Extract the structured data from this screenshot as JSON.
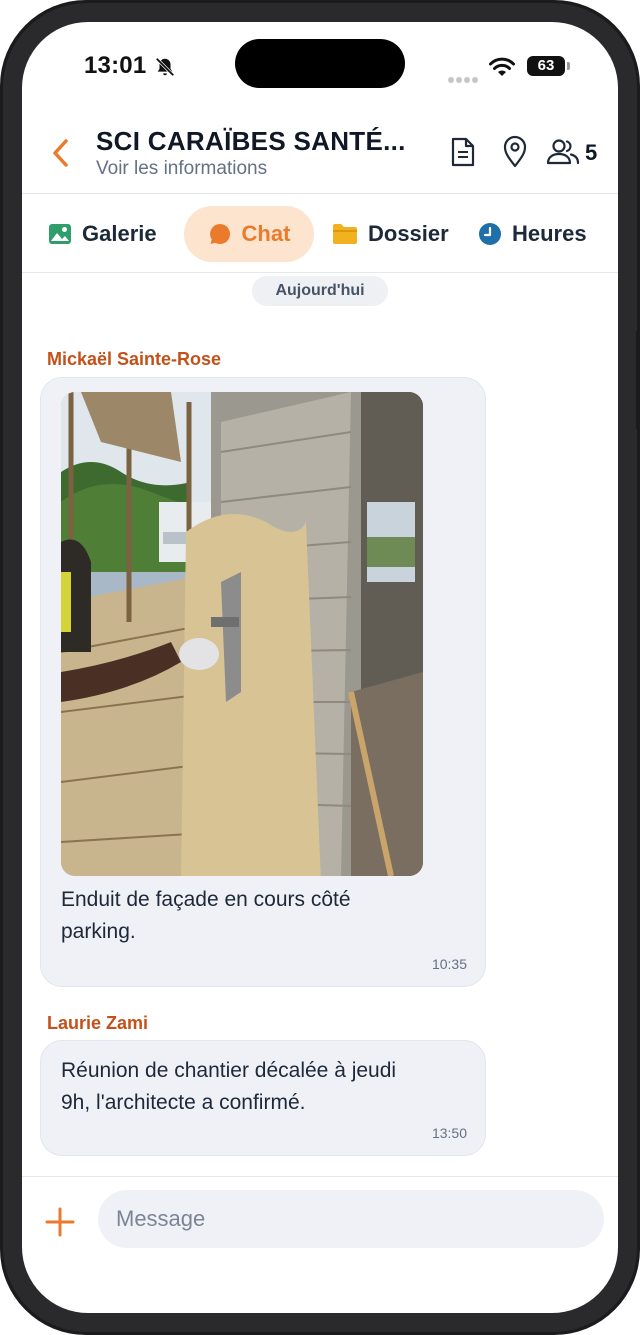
{
  "status_bar": {
    "time": "13:01",
    "battery": "63"
  },
  "header": {
    "title": "SCI CARAÏBES SANTÉ...",
    "subtitle": "Voir les informations",
    "members_count": "5"
  },
  "tabs": [
    {
      "label": "Galerie",
      "icon": "gallery-icon"
    },
    {
      "label": "Chat",
      "icon": "chat-bubble-icon",
      "active": true
    },
    {
      "label": "Dossier",
      "icon": "folder-icon"
    },
    {
      "label": "Heures",
      "icon": "clock-icon"
    }
  ],
  "chat": {
    "day_separator": "Aujourd'hui",
    "messages": [
      {
        "sender": "Mickaël Sainte-Rose",
        "line1": "Enduit de façade en cours côté",
        "line2": "parking.",
        "time": "10:35",
        "has_photo": true
      },
      {
        "sender": "Laurie Zami",
        "line1": "Réunion de chantier décalée à jeudi",
        "line2": "9h, l'architecte a confirmé.",
        "time": "13:50"
      }
    ]
  },
  "composer": {
    "placeholder": "Message"
  },
  "colors": {
    "accent": "#ea7a2c",
    "active_tab_bg": "#fde4cf",
    "sender_name": "#c4511a",
    "bubble_bg": "#eff1f6"
  }
}
